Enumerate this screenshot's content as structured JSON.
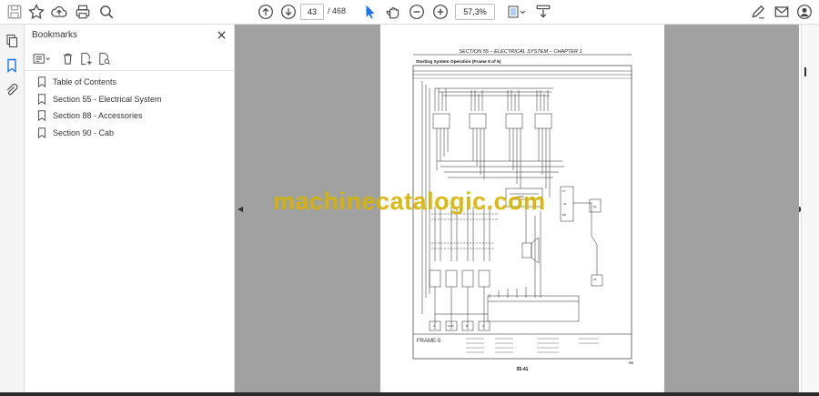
{
  "toolbar": {
    "page_current": "43",
    "page_total": "/ 468",
    "zoom": "57,3%",
    "icons": [
      "save-icon",
      "star-icon",
      "upload-icon",
      "print-icon",
      "search-zoom-icon",
      "arrow-up-icon",
      "arrow-down-icon",
      "select-cursor-icon",
      "hand-icon",
      "zoom-out-icon",
      "zoom-in-icon",
      "fit-page-icon",
      "scroll-mode-icon",
      "pen-sign-icon",
      "mail-icon",
      "account-icon"
    ]
  },
  "rail": {
    "icons": [
      "pages-icon",
      "bookmark-icon",
      "attachment-icon"
    ]
  },
  "bookmarks": {
    "title": "Bookmarks",
    "items": [
      {
        "label": "Table of Contents"
      },
      {
        "label": "Section 55 - Electrical System"
      },
      {
        "label": "Section 88 - Accessories"
      },
      {
        "label": "Section 90 - Cab"
      }
    ]
  },
  "document": {
    "header": "SECTION 55 – ELECTRICAL SYSTEM – CHAPTER 1",
    "subtitle": "Starting System Operation (Frame 5 of 5)",
    "frame_label": "FRAME-5",
    "page_number": "55-41",
    "corner_number": "30",
    "watermark": "machinecatalogic.com"
  },
  "colors": {
    "doc_bg": "#a1a1a1",
    "accent": "#1a73e8",
    "watermark": "#d7b400"
  }
}
